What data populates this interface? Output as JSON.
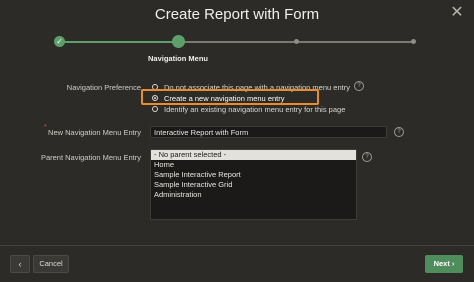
{
  "dialog": {
    "title": "Create Report with Form",
    "close_symbol": "✕"
  },
  "wizard": {
    "current_step_label": "Navigation Menu",
    "done_symbol": "✓"
  },
  "form": {
    "navigation_preference": {
      "label": "Navigation Preference",
      "options": [
        {
          "label": "Do not associate this page with a navigation menu entry",
          "selected": false
        },
        {
          "label": "Create a new navigation menu entry",
          "selected": true
        },
        {
          "label": "Identify an existing navigation menu entry for this page",
          "selected": false
        }
      ]
    },
    "new_entry": {
      "label": "New Navigation Menu Entry",
      "required_marker": "*",
      "value": "Interactive Report with Form"
    },
    "parent_entry": {
      "label": "Parent Navigation Menu Entry",
      "options": [
        "- No parent selected -",
        "Home",
        "Sample Interactive Report",
        "Sample Interactive Grid",
        "Administration"
      ],
      "selected_index": 0
    },
    "help_symbol": "?"
  },
  "footer": {
    "back_symbol": "‹",
    "cancel_label": "Cancel",
    "next_label": "Next ›"
  },
  "colors": {
    "accent_green": "#5da06a",
    "highlight_orange": "#e98c2b",
    "required_red": "#e0524e"
  }
}
